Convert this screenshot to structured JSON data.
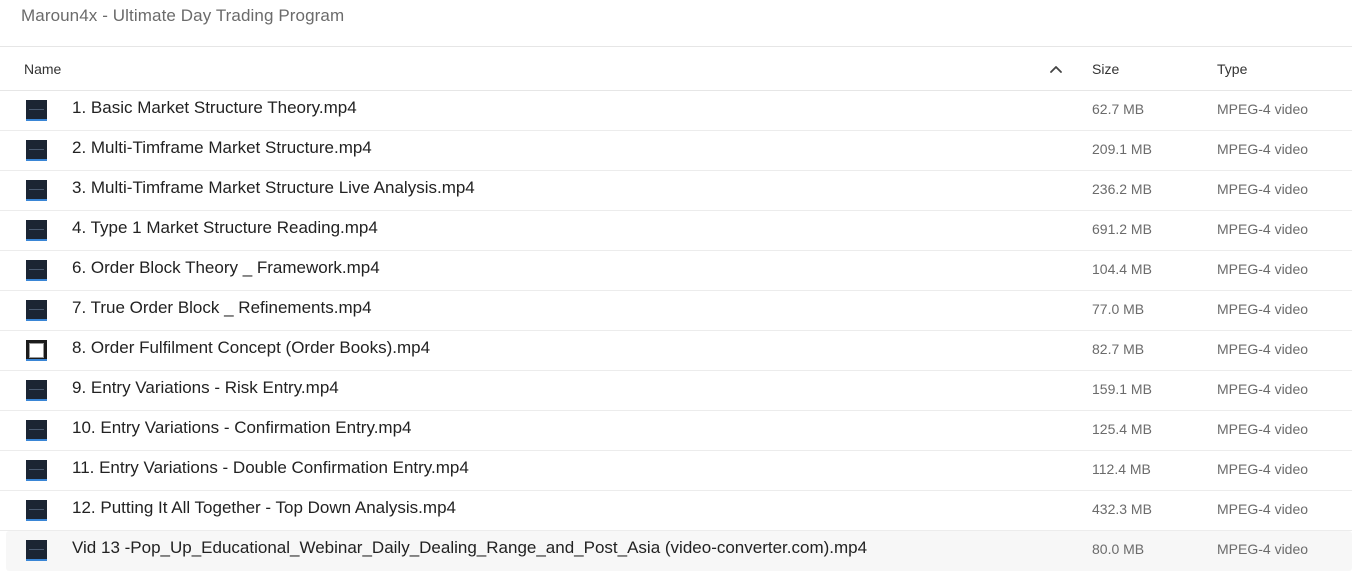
{
  "header": {
    "folder_title": "Maroun4x - Ultimate Day Trading Program"
  },
  "columns": {
    "name": "Name",
    "size": "Size",
    "type": "Type",
    "sort_direction": "ascending",
    "sort_icon": "chevron-up-icon"
  },
  "files": [
    {
      "name": "1. Basic Market Structure Theory.mp4",
      "size": "62.7 MB",
      "type": "MPEG-4 video",
      "thumbnail": "video-thumbnail-icon"
    },
    {
      "name": "2. Multi-Timframe Market Structure.mp4",
      "size": "209.1 MB",
      "type": "MPEG-4 video",
      "thumbnail": "video-thumbnail-icon"
    },
    {
      "name": "3. Multi-Timframe Market Structure Live Analysis.mp4",
      "size": "236.2 MB",
      "type": "MPEG-4 video",
      "thumbnail": "video-thumbnail-icon"
    },
    {
      "name": "4. Type 1 Market Structure Reading.mp4",
      "size": "691.2 MB",
      "type": "MPEG-4 video",
      "thumbnail": "video-thumbnail-icon"
    },
    {
      "name": "6. Order Block Theory _ Framework.mp4",
      "size": "104.4 MB",
      "type": "MPEG-4 video",
      "thumbnail": "video-thumbnail-icon"
    },
    {
      "name": "7. True Order Block _ Refinements.mp4",
      "size": "77.0 MB",
      "type": "MPEG-4 video",
      "thumbnail": "video-thumbnail-icon"
    },
    {
      "name": "8. Order Fulfilment Concept (Order Books).mp4",
      "size": "82.7 MB",
      "type": "MPEG-4 video",
      "thumbnail": "video-thumbnail-white-icon"
    },
    {
      "name": "9. Entry Variations - Risk Entry.mp4",
      "size": "159.1 MB",
      "type": "MPEG-4 video",
      "thumbnail": "video-thumbnail-icon"
    },
    {
      "name": "10. Entry Variations - Confirmation Entry.mp4",
      "size": "125.4 MB",
      "type": "MPEG-4 video",
      "thumbnail": "video-thumbnail-icon"
    },
    {
      "name": "11. Entry Variations - Double Confirmation Entry.mp4",
      "size": "112.4 MB",
      "type": "MPEG-4 video",
      "thumbnail": "video-thumbnail-icon"
    },
    {
      "name": "12. Putting It All Together - Top Down Analysis.mp4",
      "size": "432.3 MB",
      "type": "MPEG-4 video",
      "thumbnail": "video-thumbnail-icon"
    },
    {
      "name": "Vid 13 -Pop_Up_Educational_Webinar_Daily_Dealing_Range_and_Post_Asia (video-converter.com).mp4",
      "size": "80.0 MB",
      "type": "MPEG-4 video",
      "thumbnail": "video-thumbnail-icon"
    }
  ]
}
